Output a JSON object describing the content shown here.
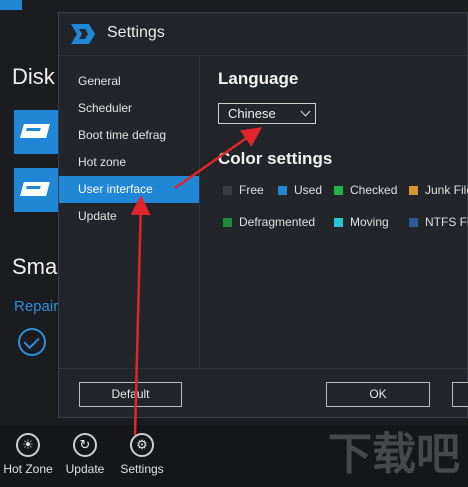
{
  "background": {
    "disk_heading": "Disk",
    "smart_heading": "Sma",
    "repair_link": "Repair"
  },
  "toolbar": {
    "items": [
      {
        "label": "Hot Zone",
        "icon": "brightness-icon"
      },
      {
        "label": "Update",
        "icon": "refresh-icon"
      },
      {
        "label": "Settings",
        "icon": "gear-icon"
      }
    ]
  },
  "watermark": "下载吧",
  "settings": {
    "title": "Settings",
    "nav": [
      {
        "label": "General"
      },
      {
        "label": "Scheduler"
      },
      {
        "label": "Boot time defrag"
      },
      {
        "label": "Hot zone"
      },
      {
        "label": "User interface",
        "active": true
      },
      {
        "label": "Update"
      }
    ],
    "language_heading": "Language",
    "language_value": "Chinese",
    "color_heading": "Color settings",
    "legend": [
      {
        "label": "Free",
        "color": "#3a3d42"
      },
      {
        "label": "Used",
        "color": "#1f87d6"
      },
      {
        "label": "Checked",
        "color": "#22b04b"
      },
      {
        "label": "Junk File",
        "color": "#d9952a"
      },
      {
        "label": "Defragmented",
        "color": "#1e8a3a"
      },
      {
        "label": "Moving",
        "color": "#25c4d8"
      },
      {
        "label": "NTFS Fil",
        "color": "#2a5a9a"
      }
    ],
    "buttons": {
      "default": "Default",
      "ok": "OK"
    }
  },
  "colors": {
    "accent": "#1f87d6",
    "annotation_arrow": "#e0262b"
  }
}
